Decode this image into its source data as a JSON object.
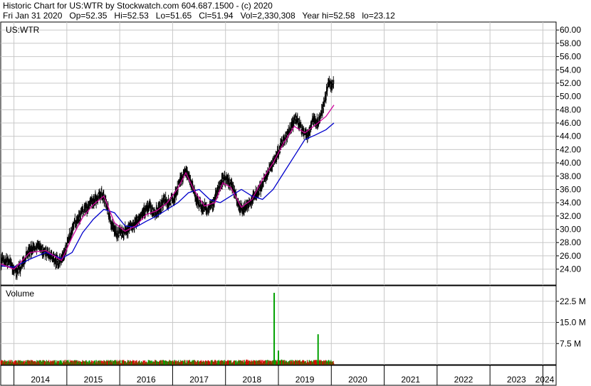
{
  "header": {
    "title_line": "Historic Chart for US:WTR by Stockwatch.com 604.687.1500 - (c) 2020",
    "stats_line": "Fri Jan 31 2020   Op=52.35   Hi=52.53   Lo=51.65   Cl=51.94   Vol=2,330,308   Year hi=52.58   lo=23.12"
  },
  "colors": {
    "background": "#ffffff",
    "grid": "#c8c8c8",
    "price_bars": "#000000",
    "short_ma": "#cc0099",
    "long_ma": "#0000cc",
    "volume_up": "#00a000",
    "volume_down": "#dd0000"
  },
  "chart_data": [
    {
      "type": "line",
      "panel": "price",
      "label": "US:WTR",
      "y_ticks": [
        "60.00",
        "58.00",
        "56.00",
        "54.00",
        "52.00",
        "50.00",
        "48.00",
        "46.00",
        "44.00",
        "42.00",
        "40.00",
        "38.00",
        "36.00",
        "34.00",
        "32.00",
        "30.00",
        "28.00",
        "26.00",
        "24.00"
      ],
      "ylim": [
        21.6,
        61.2
      ],
      "x_ticks": [
        "2014",
        "2015",
        "2016",
        "2017",
        "2018",
        "2019",
        "2020",
        "2021",
        "2022",
        "2023",
        "2024"
      ],
      "xlim": [
        2013.75,
        2024.25
      ],
      "grid": true,
      "series": [
        {
          "role": "price",
          "x": [
            2013.75,
            2013.85,
            2013.95,
            2014.05,
            2014.15,
            2014.25,
            2014.35,
            2014.45,
            2014.55,
            2014.65,
            2014.75,
            2014.85,
            2014.95,
            2015.05,
            2015.15,
            2015.25,
            2015.35,
            2015.45,
            2015.55,
            2015.65,
            2015.75,
            2015.85,
            2015.95,
            2016.05,
            2016.15,
            2016.25,
            2016.35,
            2016.45,
            2016.55,
            2016.65,
            2016.75,
            2016.85,
            2016.95,
            2017.05,
            2017.15,
            2017.25,
            2017.35,
            2017.45,
            2017.55,
            2017.65,
            2017.75,
            2017.85,
            2017.95,
            2018.05,
            2018.15,
            2018.25,
            2018.35,
            2018.45,
            2018.55,
            2018.65,
            2018.75,
            2018.85,
            2018.95,
            2019.05,
            2019.15,
            2019.25,
            2019.35,
            2019.45,
            2019.55,
            2019.65,
            2019.75,
            2019.85,
            2019.95,
            2020.05
          ],
          "values": [
            25.0,
            25.5,
            24.5,
            23.5,
            24.5,
            26.5,
            27.0,
            27.5,
            26.5,
            26.5,
            25.5,
            25.0,
            26.0,
            29.0,
            31.0,
            32.0,
            33.0,
            34.0,
            34.5,
            35.5,
            34.0,
            30.5,
            29.5,
            29.5,
            30.0,
            30.5,
            31.5,
            32.5,
            33.5,
            32.5,
            33.0,
            34.5,
            34.0,
            35.0,
            37.5,
            39.0,
            37.0,
            34.5,
            33.5,
            33.0,
            33.5,
            36.0,
            37.5,
            37.5,
            36.0,
            33.5,
            33.0,
            34.0,
            35.0,
            36.0,
            37.5,
            39.5,
            40.5,
            42.5,
            44.0,
            45.5,
            46.5,
            45.0,
            44.0,
            46.5,
            46.0,
            48.5,
            52.0,
            51.9
          ]
        },
        {
          "role": "short moving average",
          "x": [
            2013.75,
            2014.0,
            2014.3,
            2014.6,
            2014.9,
            2015.1,
            2015.3,
            2015.5,
            2015.7,
            2015.9,
            2016.1,
            2016.3,
            2016.5,
            2016.7,
            2016.9,
            2017.1,
            2017.25,
            2017.4,
            2017.6,
            2017.8,
            2017.95,
            2018.1,
            2018.3,
            2018.5,
            2018.7,
            2018.9,
            2019.1,
            2019.3,
            2019.5,
            2019.7,
            2019.9,
            2020.05
          ],
          "values": [
            24.8,
            24.0,
            26.5,
            26.8,
            25.3,
            28.8,
            31.8,
            33.7,
            35.0,
            31.0,
            29.7,
            30.5,
            32.2,
            32.8,
            34.0,
            36.2,
            38.5,
            36.0,
            33.5,
            34.0,
            37.0,
            36.3,
            33.3,
            34.5,
            37.5,
            40.0,
            43.0,
            45.5,
            44.5,
            45.7,
            47.0,
            48.7
          ]
        },
        {
          "role": "long moving average",
          "x": [
            2013.75,
            2014.0,
            2014.3,
            2014.6,
            2014.9,
            2015.1,
            2015.3,
            2015.5,
            2015.7,
            2015.9,
            2016.1,
            2016.3,
            2016.5,
            2016.7,
            2016.9,
            2017.1,
            2017.3,
            2017.5,
            2017.7,
            2017.9,
            2018.1,
            2018.3,
            2018.5,
            2018.7,
            2018.9,
            2019.1,
            2019.3,
            2019.5,
            2019.7,
            2019.9,
            2020.05
          ],
          "values": [
            24.5,
            24.3,
            25.5,
            26.5,
            25.6,
            26.5,
            29.5,
            31.5,
            33.0,
            32.5,
            30.5,
            30.3,
            31.2,
            32.0,
            33.0,
            34.0,
            35.5,
            36.0,
            34.5,
            34.0,
            35.0,
            36.0,
            35.0,
            34.5,
            36.0,
            38.5,
            41.0,
            43.5,
            44.2,
            45.0,
            46.0
          ]
        }
      ]
    },
    {
      "type": "bar",
      "panel": "volume",
      "label": "Volume",
      "y_ticks": [
        "22.5 M",
        "15.0 M",
        "7.5 M"
      ],
      "ylim": [
        0,
        28.0
      ],
      "unit": "M",
      "spikes": [
        {
          "x": 2018.92,
          "value": 25.5,
          "direction": "up"
        },
        {
          "x": 2019.0,
          "value": 5.0,
          "direction": "up"
        },
        {
          "x": 2019.06,
          "value": 1.8,
          "direction": "up"
        },
        {
          "x": 2019.75,
          "value": 10.8,
          "direction": "up"
        },
        {
          "x": 2019.7,
          "value": 1.6,
          "direction": "down"
        },
        {
          "x": 2018.4,
          "value": 1.8,
          "direction": "down"
        },
        {
          "x": 2018.55,
          "value": 1.5,
          "direction": "down"
        }
      ],
      "baseline_max": 1.4
    }
  ]
}
